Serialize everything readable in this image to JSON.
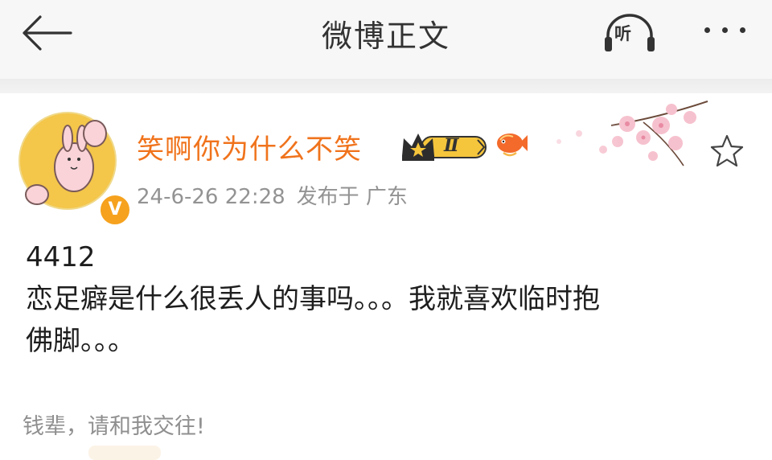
{
  "header": {
    "title": "微博正文",
    "listen_label": "听"
  },
  "post": {
    "username": "笑啊你为什么不笑",
    "badge_level": "Ⅱ",
    "verified_mark": "V",
    "time": "24-6-26 22:28",
    "published_label": "发布于 广东",
    "lines": [
      "4412",
      "恋足癖是什么很丢人的事吗。。。我就喜欢临时抱",
      "佛脚。。。"
    ],
    "caption": "钱辈，请和我交往!"
  },
  "colors": {
    "username": "#f0731c",
    "meta": "#939393",
    "verified": "#f6a21e",
    "header_bg": "#f7f7f7"
  },
  "icons": [
    "back-arrow-icon",
    "headphones-icon",
    "more-dots-icon",
    "crown-badge-icon",
    "fish-icon",
    "star-icon",
    "cherry-blossom-decoration"
  ]
}
